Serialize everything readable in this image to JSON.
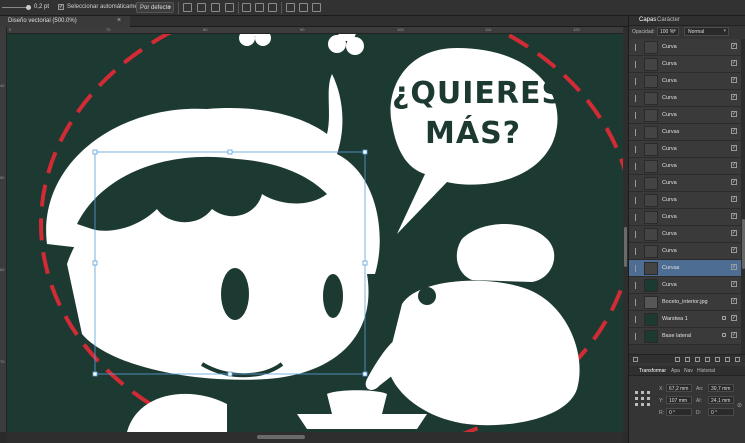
{
  "toolbar": {
    "stroke_width": "0,2 pt",
    "auto_select_checked": "✓",
    "auto_select_label": "Seleccionar automáticamente:",
    "auto_select_value": "Por defecto"
  },
  "document": {
    "tab_title": "Diseño vectorial (500.0%)",
    "close_glyph": "×"
  },
  "ruler": {
    "h_ticks": [
      "0",
      "70",
      "80",
      "90",
      "100",
      "110",
      "120"
    ],
    "v_ticks": [
      "40",
      "50",
      "60",
      "70"
    ]
  },
  "artwork": {
    "speech_line1": "¿QUIERES",
    "speech_line2": "MÁS?",
    "colors": {
      "background": "#1d3a32",
      "ink": "#ffffff",
      "dash": "#d22b35"
    }
  },
  "layers_panel": {
    "tabs": [
      "Capas",
      "Carácter"
    ],
    "opacity_label": "Opacidad:",
    "opacity_value": "100 %",
    "blend_mode": "Normal",
    "layers": [
      {
        "name": "Curva",
        "thumb": "plain",
        "selected": false,
        "locked": false,
        "checked": "✓"
      },
      {
        "name": "Curva",
        "thumb": "plain",
        "selected": false,
        "locked": false,
        "checked": "✓"
      },
      {
        "name": "Curva",
        "thumb": "plain",
        "selected": false,
        "locked": false,
        "checked": "✓"
      },
      {
        "name": "Curva",
        "thumb": "plain",
        "selected": false,
        "locked": false,
        "checked": "✓"
      },
      {
        "name": "Curva",
        "thumb": "plain",
        "selected": false,
        "locked": false,
        "checked": "✓"
      },
      {
        "name": "Curvas",
        "thumb": "plain",
        "selected": false,
        "locked": false,
        "checked": "✓"
      },
      {
        "name": "Curva",
        "thumb": "plain",
        "selected": false,
        "locked": false,
        "checked": "✓"
      },
      {
        "name": "Curva",
        "thumb": "plain",
        "selected": false,
        "locked": false,
        "checked": "✓"
      },
      {
        "name": "Curva",
        "thumb": "plain",
        "selected": false,
        "locked": false,
        "checked": "✓"
      },
      {
        "name": "Curva",
        "thumb": "plain",
        "selected": false,
        "locked": false,
        "checked": "✓"
      },
      {
        "name": "Curva",
        "thumb": "plain",
        "selected": false,
        "locked": false,
        "checked": "✓"
      },
      {
        "name": "Curva",
        "thumb": "plain",
        "selected": false,
        "locked": false,
        "checked": "✓"
      },
      {
        "name": "Curva",
        "thumb": "plain",
        "selected": false,
        "locked": false,
        "checked": "✓"
      },
      {
        "name": "Curvas",
        "thumb": "plain",
        "selected": true,
        "locked": false,
        "checked": "✓"
      },
      {
        "name": "Curva",
        "thumb": "dark",
        "selected": false,
        "locked": false,
        "checked": "✓"
      },
      {
        "name": "Boceto_interior.jpg",
        "thumb": "gray",
        "selected": false,
        "locked": false,
        "checked": "✓"
      },
      {
        "name": "Warstwa 1",
        "thumb": "dark",
        "selected": false,
        "locked": true,
        "checked": "✓"
      },
      {
        "name": "Base lateral",
        "thumb": "dark",
        "selected": false,
        "locked": true,
        "checked": "✓"
      }
    ]
  },
  "transform_panel": {
    "tabs": [
      "Transformar",
      "Apa",
      "Nav",
      "Historial"
    ],
    "fields": [
      {
        "label": "X:",
        "value": "67,2 mm"
      },
      {
        "label": "An:",
        "value": "30,7 mm"
      },
      {
        "label": "Y:",
        "value": "107 mm"
      },
      {
        "label": "Al:",
        "value": "24,1 mm"
      },
      {
        "label": "R:",
        "value": "0 °"
      },
      {
        "label": "D:",
        "value": "0 °"
      }
    ],
    "link_glyph": "⊘"
  }
}
